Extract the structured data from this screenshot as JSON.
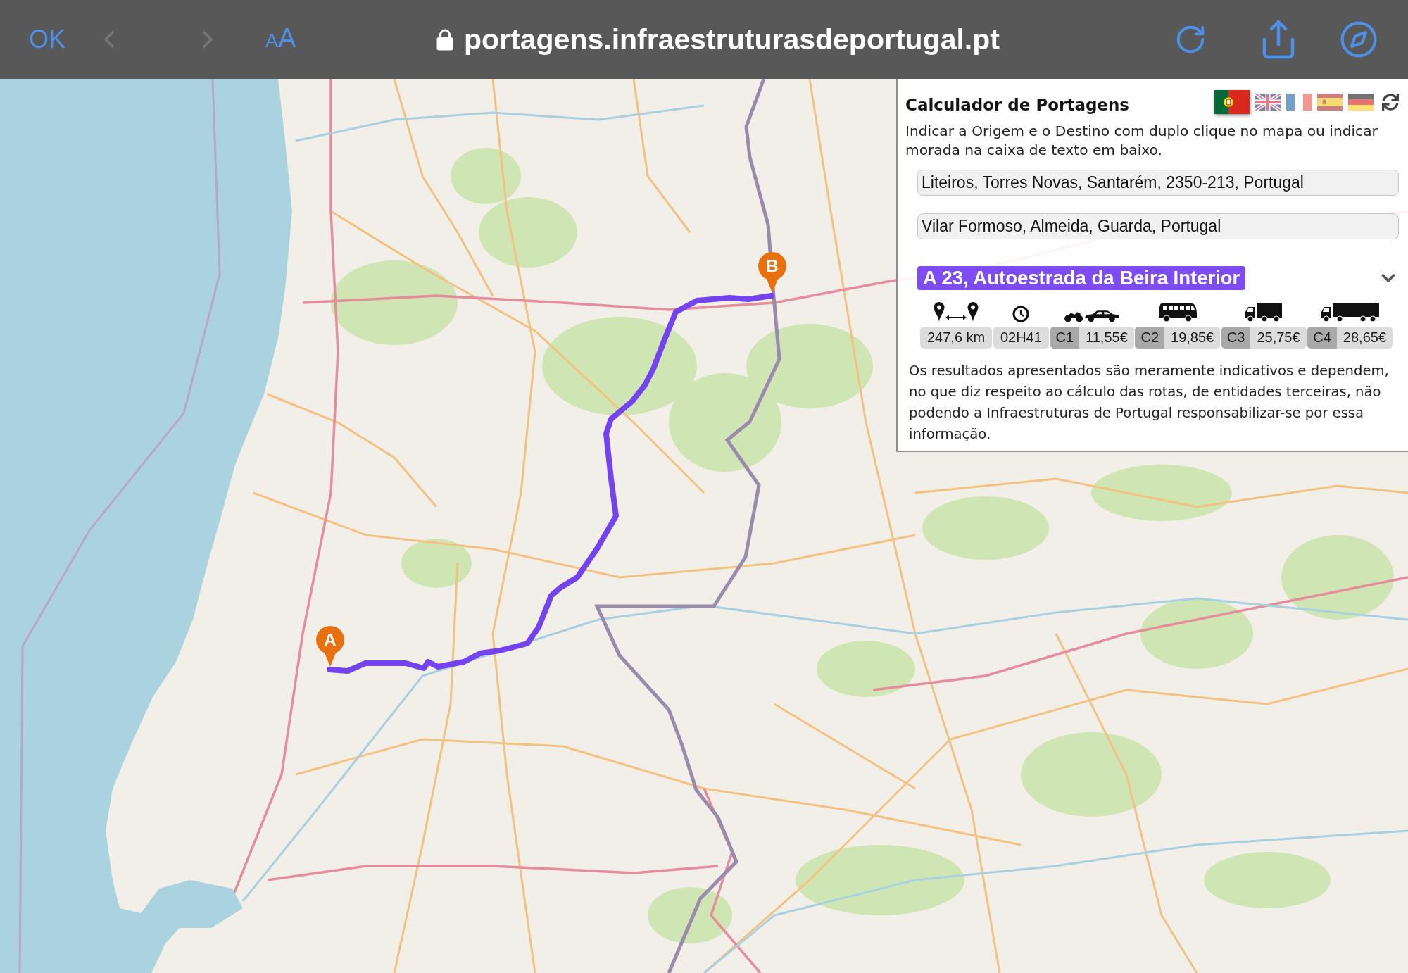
{
  "browser_bar": {
    "done_button": "OK",
    "back_disabled": true,
    "forward_disabled": true,
    "format_button": [
      "A",
      "A"
    ],
    "secure": true,
    "url": "portagens.infraestruturasdeportugal.pt"
  },
  "panel": {
    "title": "Calculador de Portagens",
    "languages": [
      {
        "kind": "portugal",
        "selected": true
      },
      {
        "kind": "uk",
        "selected": false
      },
      {
        "kind": "france",
        "selected": false
      },
      {
        "kind": "spain",
        "selected": false
      },
      {
        "kind": "germany",
        "selected": false
      }
    ],
    "instructions": "Indicar a Origem e o Destino com duplo clique no mapa ou indicar morada na caixa de texto em baixo.",
    "origin": "Liteiros, Torres Novas, Santarém, 2350-213, Portugal",
    "destination": "Vilar Formoso, Almeida, Guarda, Portugal",
    "route": {
      "name": "A 23, Autoestrada da Beira Interior",
      "stats": [
        {
          "kind": "distance",
          "value": "247,6 km"
        },
        {
          "kind": "duration",
          "value": "02H41"
        },
        {
          "kind": "class1",
          "class": "C1",
          "price": "11,55€"
        },
        {
          "kind": "class2",
          "class": "C2",
          "price": "19,85€"
        },
        {
          "kind": "class3",
          "class": "C3",
          "price": "25,75€"
        },
        {
          "kind": "class4",
          "class": "C4",
          "price": "28,65€"
        }
      ]
    },
    "disclaimer": "Os resultados apresentados são meramente indicativos e dependem, no que diz respeito ao cálculo das rotas, de entidades terceiras, não podendo a Infraestruturas de Portugal responsabilizar-se por essa informação."
  },
  "map": {
    "markers": [
      {
        "label": "A"
      },
      {
        "label": "B"
      }
    ]
  }
}
